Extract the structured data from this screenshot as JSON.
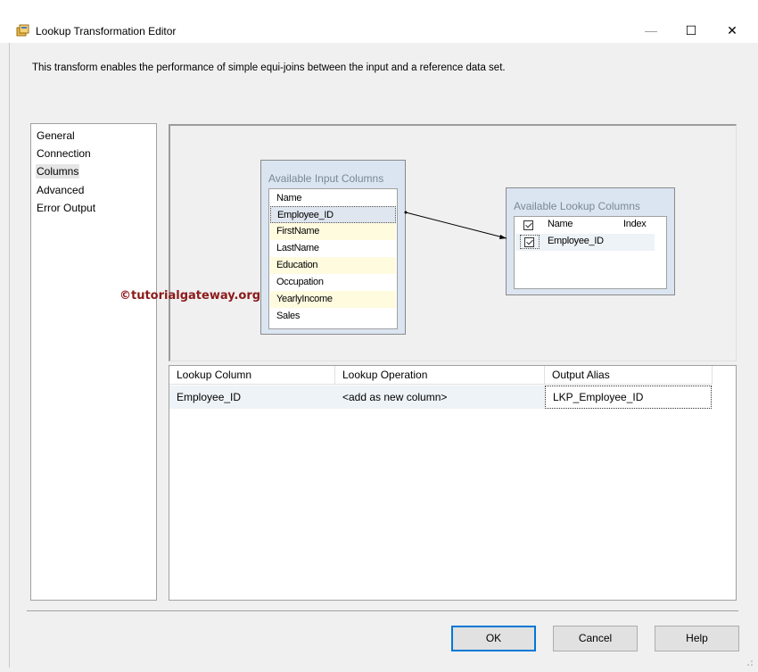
{
  "window": {
    "title": "Lookup Transformation Editor",
    "minimize": "—",
    "maximize": "☐",
    "close": "✕"
  },
  "description": "This transform enables the performance of simple equi-joins between the input and a reference data set.",
  "nav": {
    "items": [
      {
        "label": "General"
      },
      {
        "label": "Connection"
      },
      {
        "label": "Columns"
      },
      {
        "label": "Advanced"
      },
      {
        "label": "Error Output"
      }
    ],
    "selected": "Columns"
  },
  "input_columns": {
    "title": "Available Input Columns",
    "header": "Name",
    "rows": [
      {
        "name": "Employee_ID"
      },
      {
        "name": "FirstName"
      },
      {
        "name": "LastName"
      },
      {
        "name": "Education"
      },
      {
        "name": "Occupation"
      },
      {
        "name": "YearlyIncome"
      },
      {
        "name": "Sales"
      }
    ]
  },
  "lookup_columns": {
    "title": "Available Lookup Columns",
    "header_name": "Name",
    "header_index": "Index",
    "rows": [
      {
        "name": "Employee_ID",
        "checked": true
      }
    ]
  },
  "watermark": "©tutorialgateway.org",
  "grid": {
    "headers": [
      "Lookup Column",
      "Lookup Operation",
      "Output Alias"
    ],
    "rows": [
      {
        "lookup_column": "Employee_ID",
        "lookup_operation": "<add as new column>",
        "output_alias": "LKP_Employee_ID"
      }
    ]
  },
  "buttons": {
    "ok": "OK",
    "cancel": "Cancel",
    "help": "Help"
  },
  "colors": {
    "accent": "#0078d7",
    "watermark": "#8b1a1a",
    "box_bg": "#dbe5f1",
    "row_alt": "#fffbdf"
  }
}
